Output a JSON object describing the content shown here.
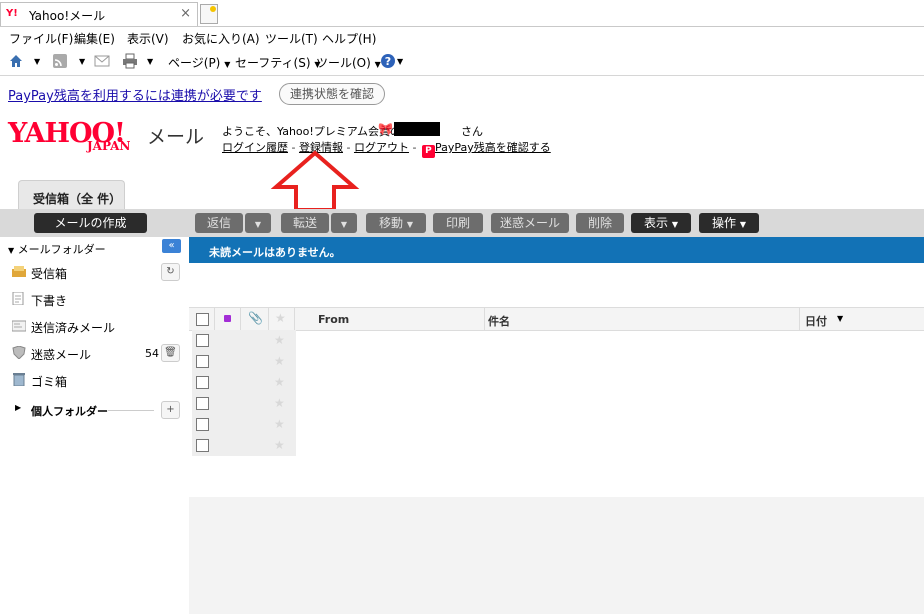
{
  "browser": {
    "tab_title": "Yahoo!メール",
    "tab_favicon": "Y!",
    "close_glyph": "×"
  },
  "menubar": [
    "ファイル(F)",
    "編集(E)",
    "表示(V)",
    "お気に入り(A)",
    "ツール(T)",
    "ヘルプ(H)"
  ],
  "commandbar": {
    "page": "ページ(P)",
    "safety": "セーフティ(S)",
    "tools": "ツール(O)",
    "icons": [
      "home-icon",
      "rss-icon",
      "mail-icon",
      "print-icon",
      "help-icon"
    ]
  },
  "notice": {
    "link": "PayPay残高を利用するには連携が必要です",
    "button": "連携状態を確認"
  },
  "header": {
    "logo_main": "YAHOO!",
    "logo_sub": "JAPAN",
    "mail_word": "メール",
    "welcome": "ようこそ、Yahoo!プレミアム会員の",
    "welcome_suffix": "さん",
    "links": {
      "login_history": "ログイン履歴",
      "registration_info": "登録情報",
      "logout": "ログアウト",
      "paypay_balance": "PayPay残高を確認する"
    },
    "link_separator": "-"
  },
  "inbox_tab": "受信箱（全 件）",
  "toolbar": {
    "compose": "メールの作成",
    "reply": "返信",
    "forward": "転送",
    "move": "移動",
    "print": "印刷",
    "spam": "迷惑メール",
    "delete": "削除",
    "view": "表示",
    "actions": "操作"
  },
  "sidebar": {
    "header": "メールフォルダー",
    "folders": [
      {
        "label": "受信箱",
        "icon": "inbox-icon"
      },
      {
        "label": "下書き",
        "icon": "draft-icon"
      },
      {
        "label": "送信済みメール",
        "icon": "sent-icon"
      },
      {
        "label": "迷惑メール",
        "icon": "shield-icon",
        "count": "54"
      },
      {
        "label": "ゴミ箱",
        "icon": "trash-icon"
      }
    ],
    "personal": "個人フォルダー",
    "add_glyph": "+"
  },
  "banner": "未読メールはありません。",
  "list": {
    "columns": {
      "from": "From",
      "subject": "件名",
      "date": "日付"
    },
    "row_count": 6
  },
  "colors": {
    "brand_red": "#ff0033",
    "banner_blue": "#1272b6",
    "arrow_red": "#e8211e",
    "toolbar_gray": "#d9d9d9"
  }
}
